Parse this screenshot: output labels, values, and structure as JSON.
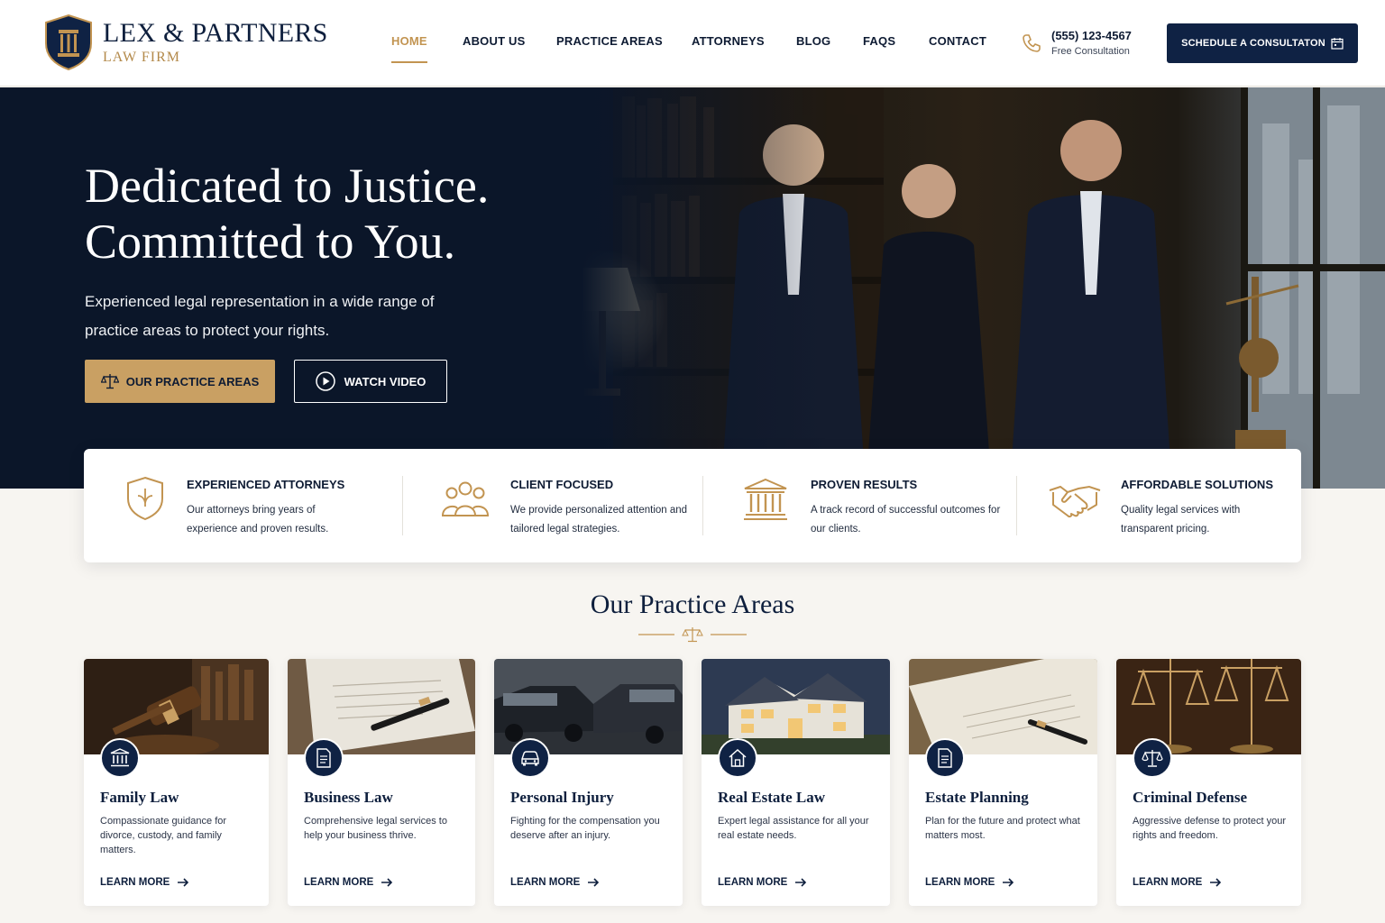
{
  "brand": {
    "name": "LEX & PARTNERS",
    "subtitle": "LAW FIRM",
    "colors": {
      "navy": "#0f2244",
      "gold": "#c29451",
      "background": "#f7f5f1"
    }
  },
  "nav": {
    "items": [
      {
        "label": "HOME",
        "active": true
      },
      {
        "label": "ABOUT US"
      },
      {
        "label": "PRACTICE AREAS"
      },
      {
        "label": "ATTORNEYS"
      },
      {
        "label": "BLOG"
      },
      {
        "label": "FAQS"
      },
      {
        "label": "CONTACT"
      }
    ]
  },
  "contact": {
    "phone": "(555) 123-4567",
    "phone_sub": "Free Consultation",
    "phone_icon": "phone-icon"
  },
  "cta": {
    "label": "SCHEDULE A CONSULTATON",
    "icon": "calendar-icon"
  },
  "hero": {
    "title_line1": "Dedicated to Justice.",
    "title_line2": "Committed to You.",
    "subtitle": "Experienced legal representation in a wide range of practice areas to protect your rights.",
    "primary_button": "OUR PRACTICE AREAS",
    "secondary_button": "WATCH VIDEO"
  },
  "features": [
    {
      "title": "EXPERIENCED ATTORNEYS",
      "desc": "Our attorneys bring years of experience and proven results.",
      "icon": "shield-icon"
    },
    {
      "title": "CLIENT FOCUSED",
      "desc": "We provide personalized attention and tailored legal strategies.",
      "icon": "people-icon"
    },
    {
      "title": "PROVEN RESULTS",
      "desc": "A track record of successful outcomes for our clients.",
      "icon": "courthouse-icon"
    },
    {
      "title": "AFFORDABLE SOLUTIONS",
      "desc": "Quality legal services with transparent pricing.",
      "icon": "handshake-icon"
    }
  ],
  "practice": {
    "title": "Our Practice Areas",
    "link_label": "LEARN MORE",
    "cards": [
      {
        "title": "Family Law",
        "desc": "Compassionate guidance for divorce, custody, and family matters.",
        "icon": "courthouse-icon"
      },
      {
        "title": "Business Law",
        "desc": "Comprehensive legal services to help your business thrive.",
        "icon": "document-icon"
      },
      {
        "title": "Personal Injury",
        "desc": "Fighting for the compensation you deserve after an injury.",
        "icon": "car-icon"
      },
      {
        "title": "Real Estate Law",
        "desc": "Expert legal assistance for all your real estate needs.",
        "icon": "house-icon"
      },
      {
        "title": "Estate Planning",
        "desc": "Plan for the future and protect what matters most.",
        "icon": "document-icon"
      },
      {
        "title": "Criminal Defense",
        "desc": "Aggressive defense to protect your rights and freedom.",
        "icon": "scales-icon"
      }
    ]
  }
}
